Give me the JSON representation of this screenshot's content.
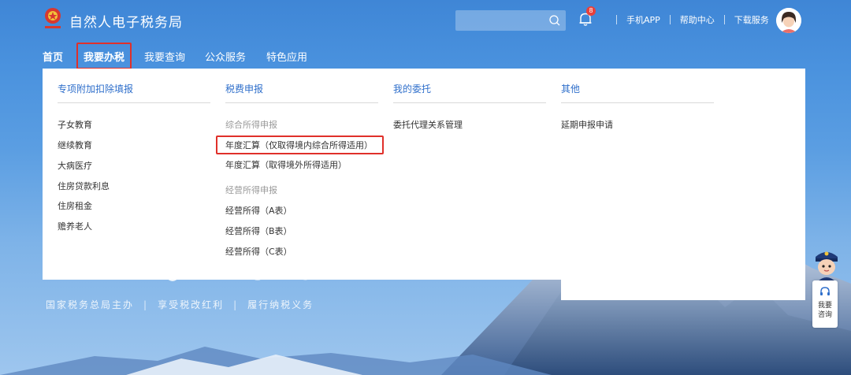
{
  "header": {
    "site_title": "自然人电子税务局",
    "search_placeholder": "",
    "notification_count": "8",
    "links": [
      "手机APP",
      "帮助中心",
      "下载服务"
    ]
  },
  "nav": {
    "home": "首页",
    "tax_handling": "我要办税",
    "query": "我要查询",
    "public_service": "公众服务",
    "special_apps": "特色应用"
  },
  "dropdown": {
    "special_deduction": {
      "title": "专项附加扣除填报",
      "items": [
        "子女教育",
        "继续教育",
        "大病医疗",
        "住房贷款利息",
        "住房租金",
        "赡养老人"
      ]
    },
    "tax_declaration": {
      "title": "税费申报",
      "comprehensive_head": "综合所得申报",
      "comprehensive_items": [
        "年度汇算（仅取得境内综合所得适用）",
        "年度汇算（取得境外所得适用）"
      ],
      "business_head": "经营所得申报",
      "business_items": [
        "经营所得（A表）",
        "经营所得（B表）",
        "经营所得（C表）"
      ]
    },
    "my_delegation": {
      "title": "我的委托",
      "items": [
        "委托代理关系管理"
      ]
    },
    "other": {
      "title": "其他",
      "items": [
        "延期申报申请"
      ]
    }
  },
  "slogan": [
    "国家税务总局主办",
    "享受税改红利",
    "履行纳税义务"
  ],
  "assistant": {
    "consult_label": "我要咨询"
  },
  "colors": {
    "brand_blue": "#3f86d6",
    "link_blue": "#2f6fcb",
    "highlight_red": "#e0302a",
    "badge_red": "#e8413c"
  }
}
